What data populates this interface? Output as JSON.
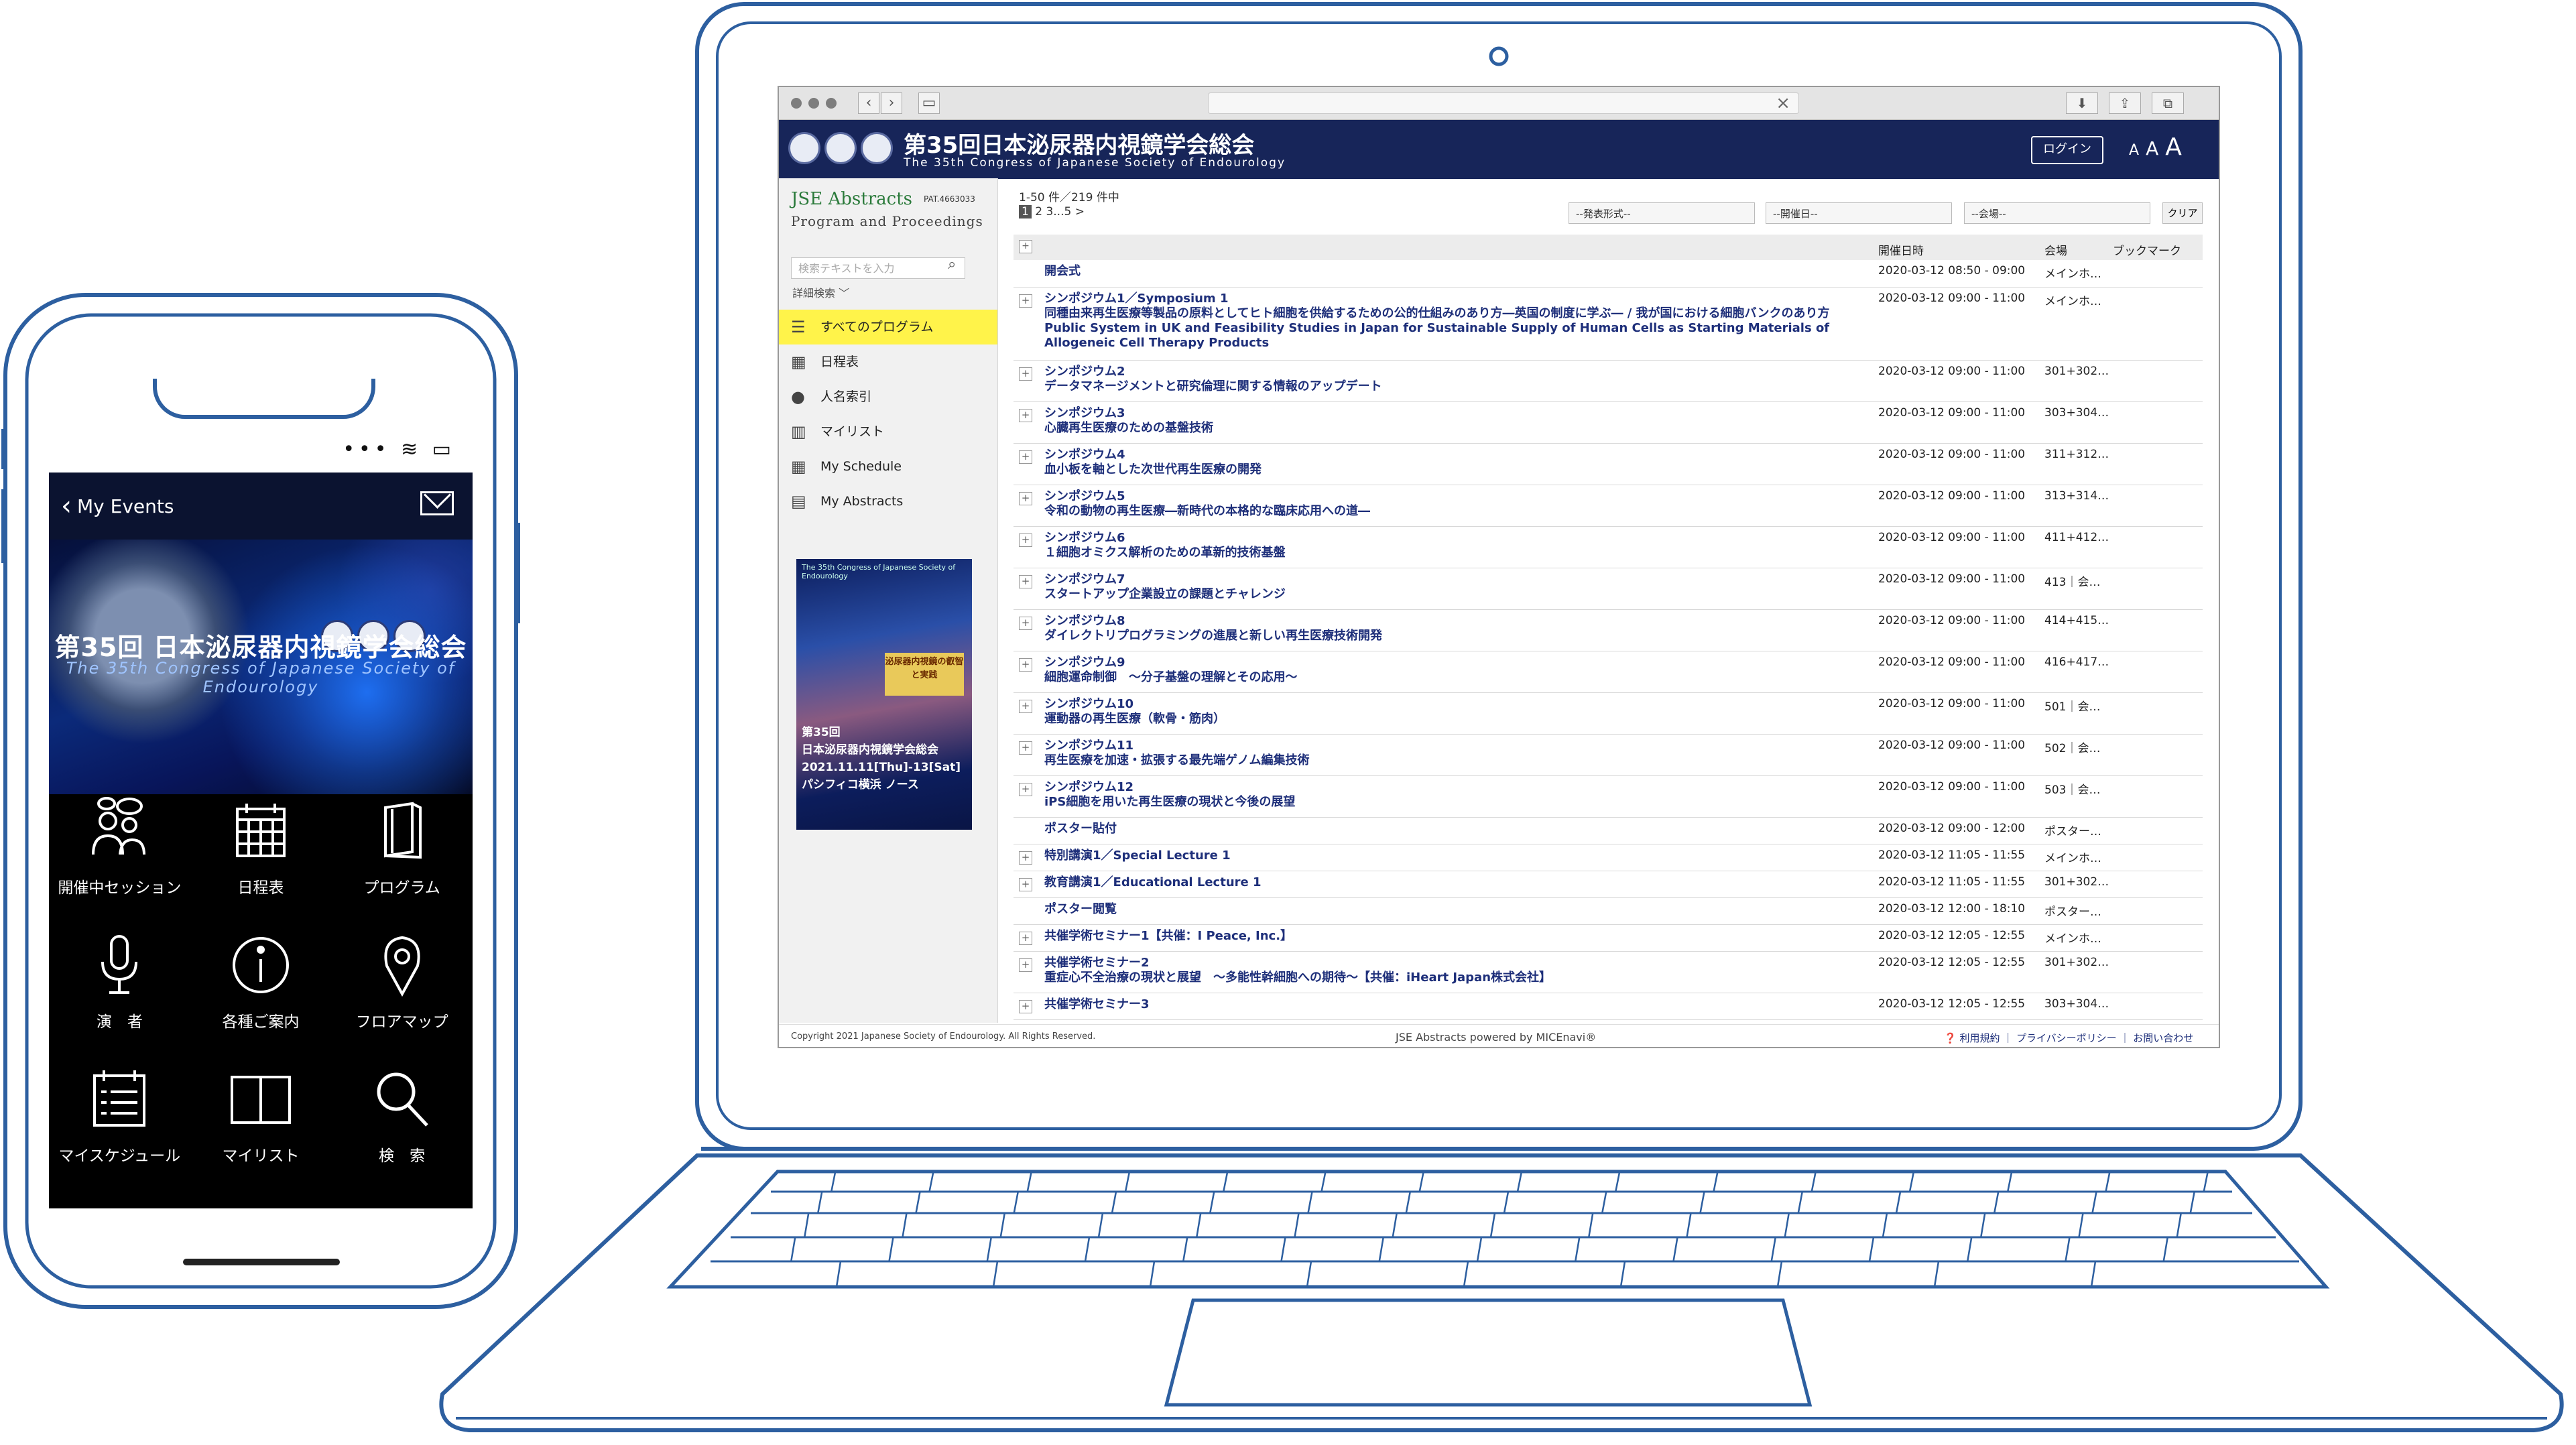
{
  "phone": {
    "status_icons": "•••  ≋  ▭",
    "nav": {
      "back_label": "My Events",
      "mail_icon": "mail-icon"
    },
    "hero": {
      "title": "第35回 日本泌尿器内視鏡学会総会",
      "subtitle": "The 35th Congress of Japanese Society of Endourology"
    },
    "tiles": [
      {
        "label": "開催中セッション",
        "icon": "people-chat-icon"
      },
      {
        "label": "日程表",
        "icon": "calendar-icon"
      },
      {
        "label": "プログラム",
        "icon": "book-icon"
      },
      {
        "label": "演　者",
        "icon": "microphone-icon"
      },
      {
        "label": "各種ご案内",
        "icon": "info-icon"
      },
      {
        "label": "フロアマップ",
        "icon": "map-pin-icon"
      },
      {
        "label": "マイスケジュール",
        "icon": "schedule-list-icon"
      },
      {
        "label": "マイリスト",
        "icon": "open-book-icon"
      },
      {
        "label": "検　索",
        "icon": "search-icon"
      }
    ]
  },
  "browser": {
    "back": "‹",
    "forward": "›",
    "url_clear": "×",
    "tools": [
      "⬇",
      "⇪",
      "⧉"
    ]
  },
  "site": {
    "title": "第35回日本泌尿器内視鏡学会総会",
    "subtitle": "The 35th Congress of Japanese Society of Endourology",
    "login": "ログイン",
    "font_sizes": [
      "A",
      "A",
      "A"
    ],
    "brand": "JSE Abstracts",
    "patent": "PAT.4663033",
    "brand_sub": "Program  and  Proceedings",
    "search_placeholder": "検索テキストを入力",
    "advanced_search": "詳細検索 ﹀",
    "menu": [
      {
        "label": "すべてのプログラム",
        "icon": "list-icon",
        "active": true
      },
      {
        "label": "日程表",
        "icon": "calendar-icon"
      },
      {
        "label": "人名索引",
        "icon": "person-icon"
      },
      {
        "label": "マイリスト",
        "icon": "book-icon"
      },
      {
        "label": "My Schedule",
        "icon": "calendar-icon"
      },
      {
        "label": "My Abstracts",
        "icon": "books-icon"
      }
    ],
    "poster": {
      "top": "The 35th Congress of Japanese Society of Endourology",
      "box": "泌尿器内視鏡の叡智と実践",
      "title": "第35回\n日本泌尿器内視鏡学会総会\n2021.11.11[Thu]-13[Sat]\nパシフィコ横浜 ノース"
    },
    "results": {
      "count": "1-50 件／219 件中",
      "pager_current": "1",
      "pager_rest": " 2 3...5  >"
    },
    "filters": [
      "--発表形式--",
      "--開催日--",
      "--会場--"
    ],
    "clear": "クリア",
    "headers": {
      "date": "開催日時",
      "venue": "会場",
      "bookmark": "ブックマーク"
    },
    "rows": [
      {
        "title": "開会式",
        "date": "2020-03-12 08:50 - 09:00",
        "venue": "メインホ…",
        "expand": false,
        "h": 40
      },
      {
        "title": "シンポジウム1／Symposium 1\n同種由来再生医療等製品の原料としてヒト細胞を供給するための公的仕組みのあり方―英国の制度に学ぶ― / 我が国における細胞バンクのあり方\nPublic System in UK and Feasibility Studies in Japan for Sustainable Supply of Human Cells as Starting Materials of\nAllogeneic Cell Therapy Products",
        "date": "2020-03-12 09:00 - 11:00",
        "venue": "メインホ…",
        "expand": true,
        "h": 108
      },
      {
        "title": "シンポジウム2\nデータマネージメントと研究倫理に関する情報のアップデート",
        "date": "2020-03-12 09:00 - 11:00",
        "venue": "301+302…",
        "expand": true,
        "h": 61
      },
      {
        "title": "シンポジウム3\n心臓再生医療のための基盤技術",
        "date": "2020-03-12 09:00 - 11:00",
        "venue": "303+304…",
        "expand": true,
        "h": 61
      },
      {
        "title": "シンポジウム4\n血小板を軸とした次世代再生医療の開発",
        "date": "2020-03-12 09:00 - 11:00",
        "venue": "311+312…",
        "expand": true,
        "h": 61
      },
      {
        "title": "シンポジウム5\n令和の動物の再生医療―新時代の本格的な臨床応用への道―",
        "date": "2020-03-12 09:00 - 11:00",
        "venue": "313+314…",
        "expand": true,
        "h": 61
      },
      {
        "title": "シンポジウム6\n１細胞オミクス解析のための革新的技術基盤",
        "date": "2020-03-12 09:00 - 11:00",
        "venue": "411+412…",
        "expand": true,
        "h": 61
      },
      {
        "title": "シンポジウム7\nスタートアップ企業設立の課題とチャレンジ",
        "date": "2020-03-12 09:00 - 11:00",
        "venue": "413｜会…",
        "expand": true,
        "h": 61
      },
      {
        "title": "シンポジウム8\nダイレクトリプログラミングの進展と新しい再生医療技術開発",
        "date": "2020-03-12 09:00 - 11:00",
        "venue": "414+415…",
        "expand": true,
        "h": 61
      },
      {
        "title": "シンポジウム9\n細胞運命制御　～分子基盤の理解とその応用～",
        "date": "2020-03-12 09:00 - 11:00",
        "venue": "416+417…",
        "expand": true,
        "h": 61
      },
      {
        "title": "シンポジウム10\n運動器の再生医療（軟骨・筋肉）",
        "date": "2020-03-12 09:00 - 11:00",
        "venue": "501｜会…",
        "expand": true,
        "h": 61
      },
      {
        "title": "シンポジウム11\n再生医療を加速・拡張する最先端ゲノム編集技術",
        "date": "2020-03-12 09:00 - 11:00",
        "venue": "502｜会…",
        "expand": true,
        "h": 61
      },
      {
        "title": "シンポジウム12\niPS細胞を用いた再生医療の現状と今後の展望",
        "date": "2020-03-12 09:00 - 11:00",
        "venue": "503｜会…",
        "expand": true,
        "h": 61
      },
      {
        "title": "ポスター貼付",
        "date": "2020-03-12 09:00 - 12:00",
        "venue": "ポスター…",
        "expand": false,
        "h": 39
      },
      {
        "title": "特別講演1／Special Lecture 1",
        "date": "2020-03-12 11:05 - 11:55",
        "venue": "メインホ…",
        "expand": true,
        "h": 39
      },
      {
        "title": "教育講演1／Educational Lecture 1",
        "date": "2020-03-12 11:05 - 11:55",
        "venue": "301+302…",
        "expand": true,
        "h": 39
      },
      {
        "title": "ポスター閲覧",
        "date": "2020-03-12 12:00 - 18:10",
        "venue": "ポスター…",
        "expand": false,
        "h": 39
      },
      {
        "title": "共催学術セミナー1【共催：I Peace, Inc.】",
        "date": "2020-03-12 12:05 - 12:55",
        "venue": "メインホ…",
        "expand": true,
        "h": 39
      },
      {
        "title": "共催学術セミナー2\n重症心不全治療の現状と展望　～多能性幹細胞への期待～【共催：iHeart Japan株式会社】",
        "date": "2020-03-12 12:05 - 12:55",
        "venue": "301+302…",
        "expand": true,
        "h": 61
      },
      {
        "title": "共催学術セミナー3",
        "date": "2020-03-12 12:05 - 12:55",
        "venue": "303+304…",
        "expand": true,
        "h": 39
      }
    ],
    "footer": {
      "copyright": "Copyright 2021 Japanese Society of Endourology. All Rights Reserved.",
      "powered": "JSE Abstracts powered by MICEnavi®",
      "links": "❓ 利用規約 ｜ プライバシーポリシー ｜ お問い合わせ"
    }
  },
  "colors": {
    "outline": "#2d5fa0",
    "header_navy": "#172559",
    "link_blue": "#1e2f7a",
    "active_menu": "#fff34a",
    "brand_green": "#2a7a3a"
  }
}
